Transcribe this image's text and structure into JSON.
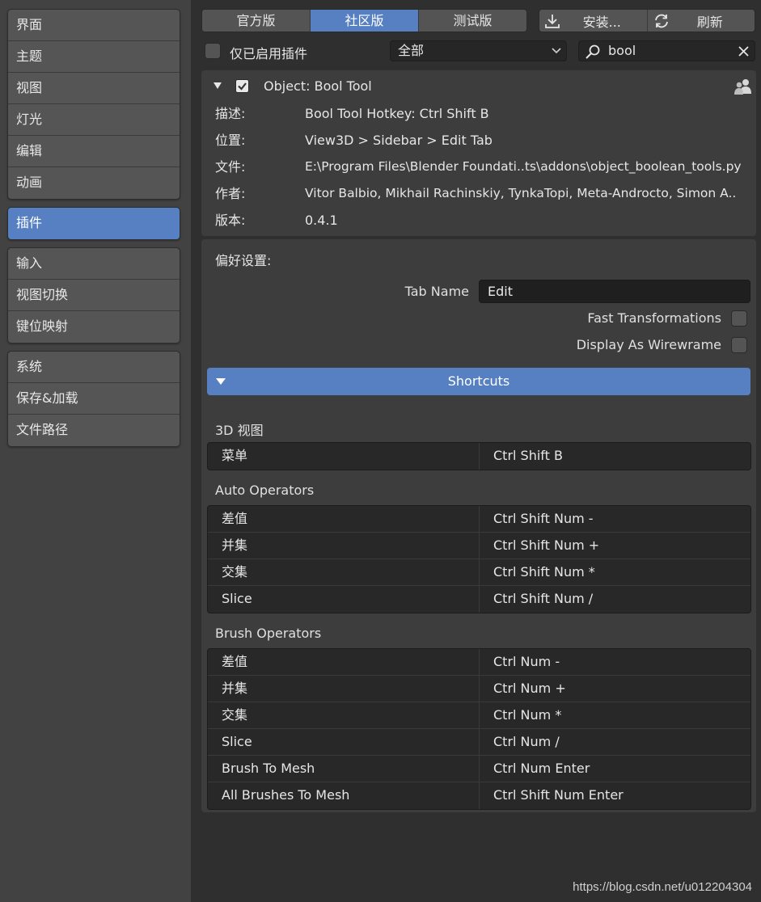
{
  "sidebar": {
    "group1": [
      "界面",
      "主题",
      "视图",
      "灯光",
      "编辑",
      "动画"
    ],
    "group2": [
      "插件"
    ],
    "group3": [
      "输入",
      "视图切换",
      "键位映射"
    ],
    "group4": [
      "系统",
      "保存&加载",
      "文件路径"
    ]
  },
  "tabs": [
    "官方版",
    "社区版",
    "测试版"
  ],
  "buttons": {
    "install": "安装...",
    "refresh": "刷新"
  },
  "filter": {
    "enabled_only_label": "仅已启用插件",
    "category": "全部",
    "search_value": "bool"
  },
  "addon": {
    "title": "Object: Bool Tool",
    "info": [
      {
        "key": "描述:",
        "value": "Bool Tool Hotkey: Ctrl Shift B"
      },
      {
        "key": "位置:",
        "value": "View3D > Sidebar > Edit Tab"
      },
      {
        "key": "文件:",
        "value": "E:\\Program Files\\Blender Foundati..ts\\addons\\object_boolean_tools.py"
      },
      {
        "key": "作者:",
        "value": "Vitor Balbio, Mikhail Rachinskiy, TynkaTopi, Meta-Androcto, Simon A.."
      },
      {
        "key": "版本:",
        "value": "0.4.1"
      }
    ]
  },
  "preferences": {
    "title": "偏好设置:",
    "tab_name_label": "Tab Name",
    "tab_name_value": "Edit",
    "fast_transform_label": "Fast Transformations",
    "wireframe_label": "Display As Wirewrame",
    "shortcuts_label": "Shortcuts"
  },
  "shortcuts": {
    "view3d_title": "3D 视图",
    "view3d": [
      {
        "name": "菜单",
        "key": "Ctrl Shift B"
      }
    ],
    "auto_title": "Auto Operators",
    "auto": [
      {
        "name": "差值",
        "key": "Ctrl Shift Num -"
      },
      {
        "name": "并集",
        "key": "Ctrl Shift Num +"
      },
      {
        "name": "交集",
        "key": "Ctrl Shift Num *"
      },
      {
        "name": "Slice",
        "key": "Ctrl Shift Num /"
      }
    ],
    "brush_title": "Brush Operators",
    "brush": [
      {
        "name": "差值",
        "key": "Ctrl Num -"
      },
      {
        "name": "并集",
        "key": "Ctrl Num +"
      },
      {
        "name": "交集",
        "key": "Ctrl Num *"
      },
      {
        "name": "Slice",
        "key": "Ctrl Num /"
      },
      {
        "name": "Brush To Mesh",
        "key": "Ctrl Num Enter"
      },
      {
        "name": "All Brushes To Mesh",
        "key": "Ctrl Shift Num Enter"
      }
    ]
  },
  "watermark": "https://blog.csdn.net/u012204304"
}
